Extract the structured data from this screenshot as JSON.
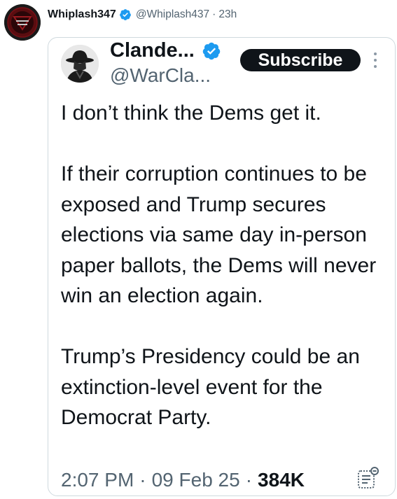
{
  "outer_post": {
    "display_name": "Whiplash347",
    "handle": "@Whiplash437",
    "separator": "·",
    "time": "23h",
    "avatar_icon": "dark-emblem-avatar",
    "verified_icon": "verified-badge-icon"
  },
  "embedded_post": {
    "display_name": "Clande...",
    "handle": "@WarCla...",
    "subscribe_label": "Subscribe",
    "avatar_icon": "hat-silhouette-avatar",
    "more_icon": "more-options-icon",
    "paragraphs": [
      "I don’t think the Dems get it.",
      "If their corruption continues to be exposed and Trump secures elections via same day in-person paper ballots, the Dems will never win an election again.",
      "Trump’s Presidency could be an extinction-level event for the Democrat Party."
    ],
    "time": "2:07 PM",
    "date": "09 Feb 25",
    "separator": "·",
    "views": "384K",
    "analytics_icon": "analytics-icon"
  },
  "colors": {
    "verified_blue": "#1d9bf0",
    "text_primary": "#0f1419",
    "text_secondary": "#536471",
    "border": "#cfd9de",
    "subscribe_bg": "#0f1419"
  }
}
